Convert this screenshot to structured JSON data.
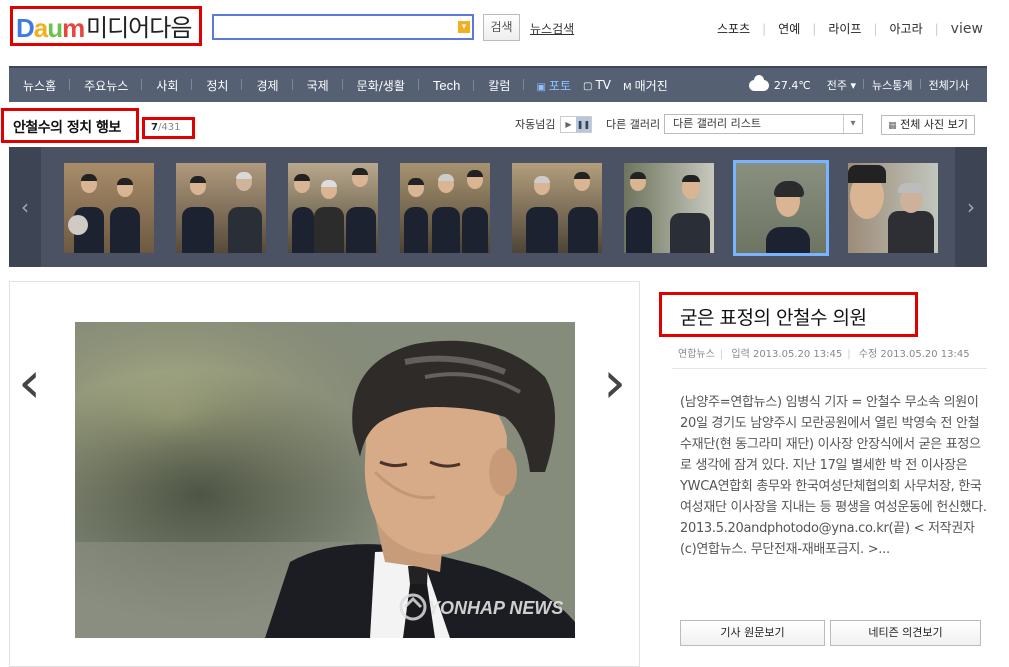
{
  "header": {
    "logo_daum": "Daum",
    "logo_media": "미디어다음",
    "search_button": "검색",
    "news_search": "뉴스검색",
    "top_nav": [
      "스포츠",
      "연예",
      "라이프",
      "아고라",
      "view"
    ]
  },
  "gnb": {
    "items": [
      "뉴스홈",
      "주요뉴스",
      "사회",
      "정치",
      "경제",
      "국제",
      "문화/생활",
      "Tech",
      "칼럼"
    ],
    "media_tabs": [
      "포토",
      "TV",
      "매거진"
    ],
    "weather_temp": "27.4℃",
    "weather_region": "전주",
    "right_links": [
      "뉴스통계",
      "전체기사"
    ]
  },
  "gallery": {
    "title": "안철수의 정치 행보",
    "counter_current": "7",
    "counter_total": "/431",
    "autoplay_label": "자동넘김",
    "other_gallery_label": "다른 갤러리",
    "select_value": "다른 갤러리 리스트",
    "view_all_button": "전체 사진 보기",
    "selected_index": 7
  },
  "article": {
    "title": "굳은 표정의 안철수 의원",
    "source": "연합뉴스",
    "input_time": "입력 2013.05.20 13:45",
    "modified_time": "수정 2013.05.20 13:45",
    "body": "(남양주=연합뉴스) 임병식 기자 = 안철수 무소속 의원이 20일 경기도 남양주시 모란공원에서 열린 박영숙 전 안철수재단(현 동그라미 재단) 이사장 안장식에서 굳은 표정으로 생각에 잠겨 있다. 지난 17일 별세한 박 전 이사장은 YWCA연합회 총무와 한국여성단체협의회 사무처장, 한국여성재단 이사장을 지내는 등 평생을 여성운동에 헌신했다. 2013.5.20andphotodo@yna.co.kr(끝) < 저작권자(c)연합뉴스. 무단전재-재배포금지. >...",
    "button_original": "기사 원문보기",
    "button_comments": "네티즌 의견보기"
  },
  "photo": {
    "watermark": "YONHAP NEWS"
  }
}
